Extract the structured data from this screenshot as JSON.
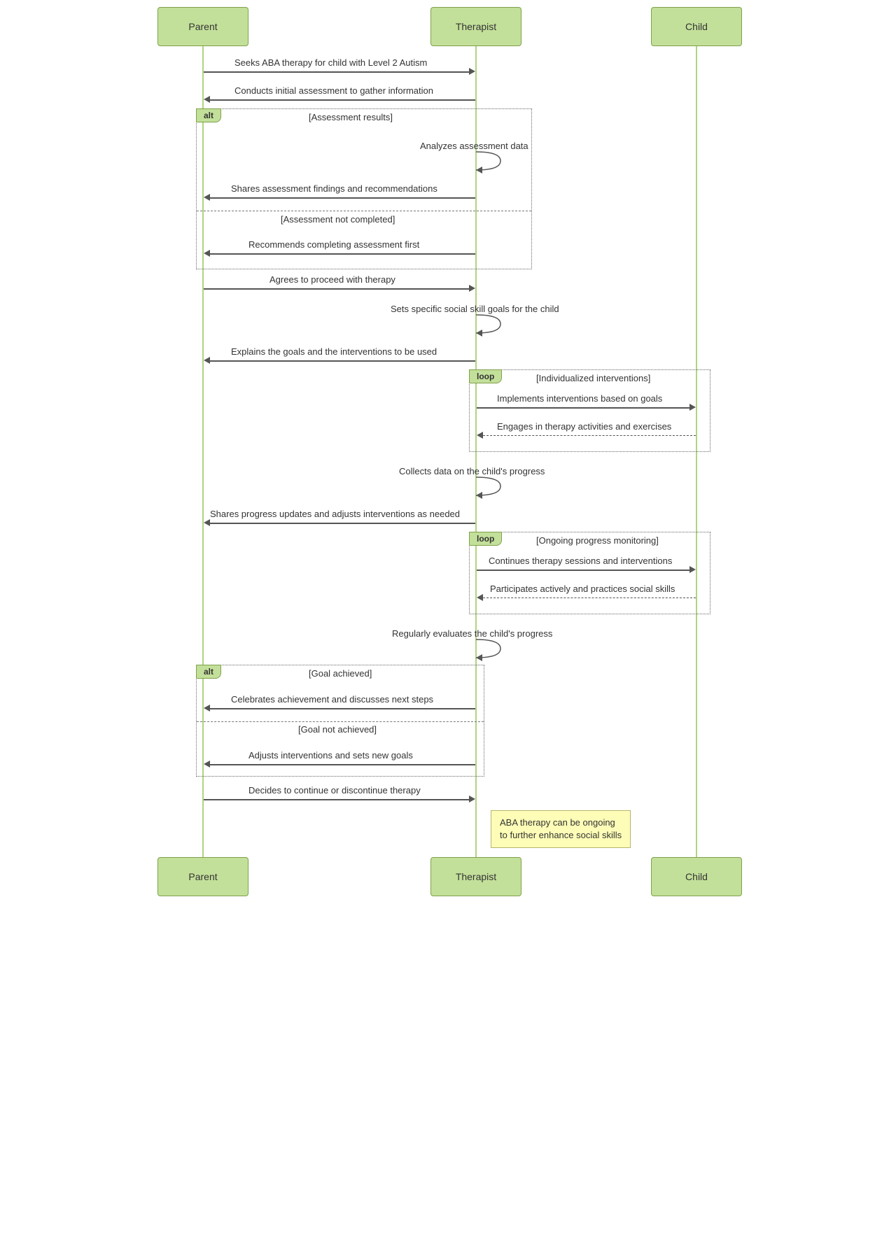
{
  "actors": {
    "parent": "Parent",
    "therapist": "Therapist",
    "child": "Child"
  },
  "fragments": {
    "alt1": {
      "label": "alt",
      "cond1": "[Assessment results]",
      "cond2": "[Assessment not completed]"
    },
    "loop1": {
      "label": "loop",
      "cond": "[Individualized interventions]"
    },
    "loop2": {
      "label": "loop",
      "cond": "[Ongoing progress monitoring]"
    },
    "alt2": {
      "label": "alt",
      "cond1": "[Goal achieved]",
      "cond2": "[Goal not achieved]"
    }
  },
  "messages": {
    "m1": "Seeks ABA therapy for child with Level 2 Autism",
    "m2": "Conducts initial assessment to gather information",
    "m3": "Analyzes assessment data",
    "m4": "Shares assessment findings and recommendations",
    "m5": "Recommends completing assessment first",
    "m6": "Agrees to proceed with therapy",
    "m7": "Sets specific social skill goals for the child",
    "m8": "Explains the goals and the interventions to be used",
    "m9": "Implements interventions based on goals",
    "m10": "Engages in therapy activities and exercises",
    "m11": "Collects data on the child's progress",
    "m12": "Shares progress updates and adjusts interventions as needed",
    "m13": "Continues therapy sessions and interventions",
    "m14": "Participates actively and practices social skills",
    "m15": "Regularly evaluates the child's progress",
    "m16": "Celebrates achievement and discusses next steps",
    "m17": "Adjusts interventions and sets new goals",
    "m18": "Decides to continue or discontinue therapy"
  },
  "note": {
    "line1": "ABA therapy can be ongoing",
    "line2": "to further enhance social skills"
  }
}
